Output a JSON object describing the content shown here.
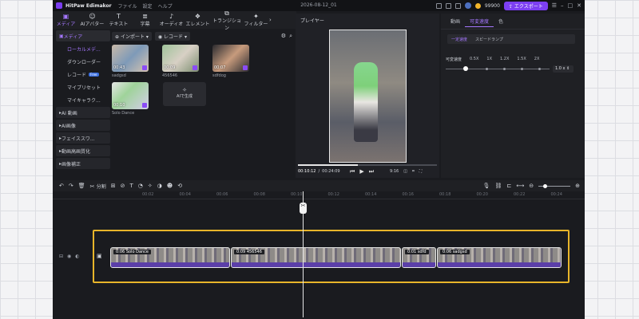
{
  "app": {
    "name": "HitPaw Edimakor",
    "menu": [
      "ファイル",
      "設定",
      "ヘルプ"
    ],
    "project_title": "2026-08-12_01",
    "credits": "99900",
    "export_label": "エクスポート"
  },
  "toolbar": [
    {
      "label": "メディア",
      "icon": "media-icon"
    },
    {
      "label": "AIアバター",
      "icon": "avatar-icon"
    },
    {
      "label": "テキスト",
      "icon": "text-icon"
    },
    {
      "label": "字幕",
      "icon": "subtitle-icon"
    },
    {
      "label": "オーディオ",
      "icon": "audio-icon"
    },
    {
      "label": "エレメント",
      "icon": "element-icon"
    },
    {
      "label": "トランジション",
      "icon": "transition-icon"
    },
    {
      "label": "フィルター",
      "icon": "filter-icon"
    }
  ],
  "sidebar": {
    "head": "メディア",
    "items": [
      "ローカルメデ...",
      "ダウンローダー",
      "レコード",
      "マイプリセット",
      "マイキャラク..."
    ],
    "record_badge": "Free",
    "groups": [
      "AI 動画",
      "AI画像",
      "フェイススワ...",
      "動画高画質化",
      "画像補正"
    ]
  },
  "media_bar": {
    "import_label": "インポート",
    "record_label": "レコード"
  },
  "media": [
    {
      "name": "sadgsd",
      "duration": "00:43"
    },
    {
      "name": "456546",
      "duration": "00:09"
    },
    {
      "name": "sdfdog",
      "duration": "00:07"
    },
    {
      "name": "Solo Dance",
      "duration": "00:10"
    }
  ],
  "ai_generate_label": "AIで生成",
  "player": {
    "title": "プレイヤー",
    "current_time": "00:10:12",
    "total_time": "00:24:09",
    "aspect": "9:16",
    "progress": 0.43
  },
  "right_panel": {
    "tabs": [
      "動画",
      "可変速度",
      "色"
    ],
    "subtabs": [
      "一定速度",
      "スピードランプ"
    ],
    "speed_label": "可変速度",
    "speed_marks": [
      "0.5X",
      "1X",
      "1.2X",
      "1.5X",
      "2X"
    ],
    "speed_value": "1.0 x"
  },
  "timeline": {
    "split_label": "分割",
    "ruler_ticks": [
      "00:02",
      "00:04",
      "00:06",
      "00:08",
      "00:10",
      "00:12",
      "00:14",
      "00:16",
      "00:18",
      "00:20",
      "00:22",
      "00:24"
    ],
    "clips": [
      {
        "label": "0:06 Solo Dance"
      },
      {
        "label": "0:09 456546"
      },
      {
        "label": "0:01 sdfd"
      },
      {
        "label": "0:06 sadgsd"
      }
    ]
  }
}
